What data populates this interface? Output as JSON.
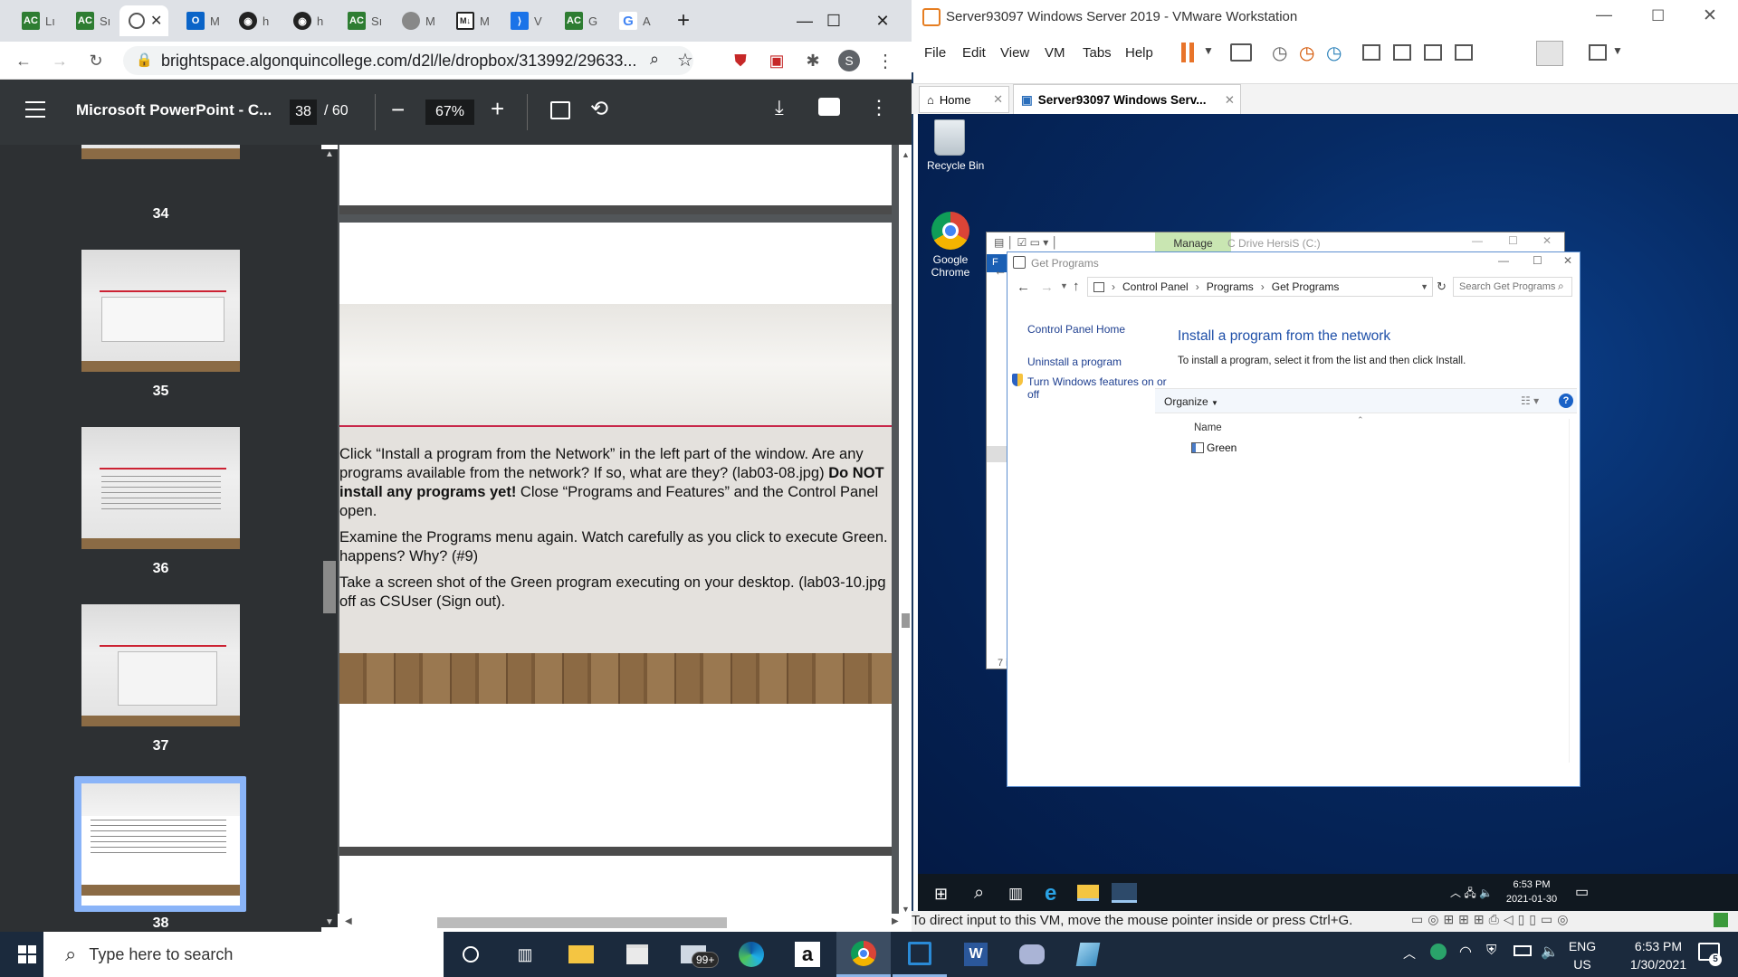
{
  "chrome": {
    "tabs": [
      {
        "icon": "ac-icon",
        "label": "Lı"
      },
      {
        "icon": "ac-icon",
        "label": "Sı"
      },
      {
        "icon": "globe-icon",
        "label": ""
      },
      {
        "icon": "outlook-icon",
        "label": "M"
      },
      {
        "icon": "github-icon",
        "label": "h"
      },
      {
        "icon": "github-icon",
        "label": "h"
      },
      {
        "icon": "ac-icon",
        "label": "Sı"
      },
      {
        "icon": "globe-icon",
        "label": "M"
      },
      {
        "icon": "markdown-icon",
        "label": "M"
      },
      {
        "icon": "vscode-icon",
        "label": "V"
      },
      {
        "icon": "ac-icon",
        "label": "G"
      },
      {
        "icon": "google-icon",
        "label": "A"
      }
    ],
    "url": "brightspace.algonquincollege.com/d2l/le/dropbox/313992/29633...",
    "profile_initial": "S"
  },
  "pdf": {
    "title": "Microsoft PowerPoint - C...",
    "page_current": "38",
    "page_total": "/ 60",
    "zoom": "67%",
    "thumbnails": [
      "34",
      "35",
      "36",
      "37",
      "38"
    ],
    "slide_lines": [
      "Click “Install a program from the Network” in the left part of the window. Are any",
      "programs available from the network? If so, what are they? (lab03-08.jpg)",
      "Do NOT",
      "install any programs yet!",
      "Close “Programs and Features” and the Control Panel",
      "open.",
      "Examine the Programs menu again. Watch carefully as you click to execute Green. V",
      "happens? Why? (#9)",
      "Take a screen shot of the Green program executing on your desktop. (lab03-10.jpg",
      "off as CSUser (Sign out)."
    ]
  },
  "vmware": {
    "window_title": "Server93097 Windows Server 2019 - VMware Workstation",
    "menu": [
      "File",
      "Edit",
      "View",
      "VM",
      "Tabs",
      "Help"
    ],
    "tabs": [
      {
        "label": "Home"
      },
      {
        "label": "Server93097 Windows Serv..."
      }
    ],
    "status_text": "To direct input to this VM, move the mouse pointer inside or press Ctrl+G."
  },
  "guest": {
    "desktop_icons": [
      "Recycle Bin",
      "Google\nChrome"
    ],
    "explorer_back": {
      "manage_tab": "Manage",
      "title": "C Drive HersiS (C:)",
      "side_letter": "F",
      "items_count": "7 i"
    },
    "get_programs": {
      "title": "Get Programs",
      "breadcrumb": [
        "Control Panel",
        "Programs",
        "Get Programs"
      ],
      "search_placeholder": "Search Get Programs",
      "left_links": [
        "Control Panel Home",
        "Uninstall a program",
        "Turn Windows features on or off"
      ],
      "heading": "Install a program from the network",
      "instructions": "To install a program, select it from the list and then click Install.",
      "organize": "Organize",
      "column_name": "Name",
      "items": [
        "Green"
      ]
    },
    "tray": {
      "time": "6:53 PM",
      "date": "2021-01-30"
    }
  },
  "host_taskbar": {
    "search_placeholder": "Type here to search",
    "mail_badge": "99+",
    "lang_top": "ENG",
    "lang_bottom": "US",
    "time": "6:53 PM",
    "date": "1/30/2021",
    "notification_count": "5"
  }
}
